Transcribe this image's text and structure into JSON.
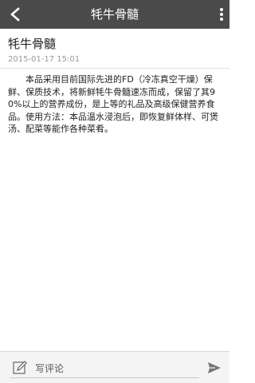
{
  "header": {
    "title": "牦牛骨髓",
    "back_icon": "back-arrow-icon",
    "menu_icon": "overflow-menu-icon",
    "background": "#4a4a4a"
  },
  "article": {
    "title": "牦牛骨髓",
    "date": "2015-01-17 15:01",
    "body": "本品采用目前国际先进的FD（冷冻真空干燥）保鲜、保质技术，将新鲜牦牛骨髓速冻而成，保留了其90%以上的营养成份，是上等的礼品及高级保健营养食品。使用方法：本品温水浸泡后，即恢复鲜体样、可煲汤、配菜等能作各种菜肴。"
  },
  "footer": {
    "comment_placeholder": "写评论",
    "edit_icon": "pencil-edit-icon",
    "send_icon": "send-icon"
  }
}
